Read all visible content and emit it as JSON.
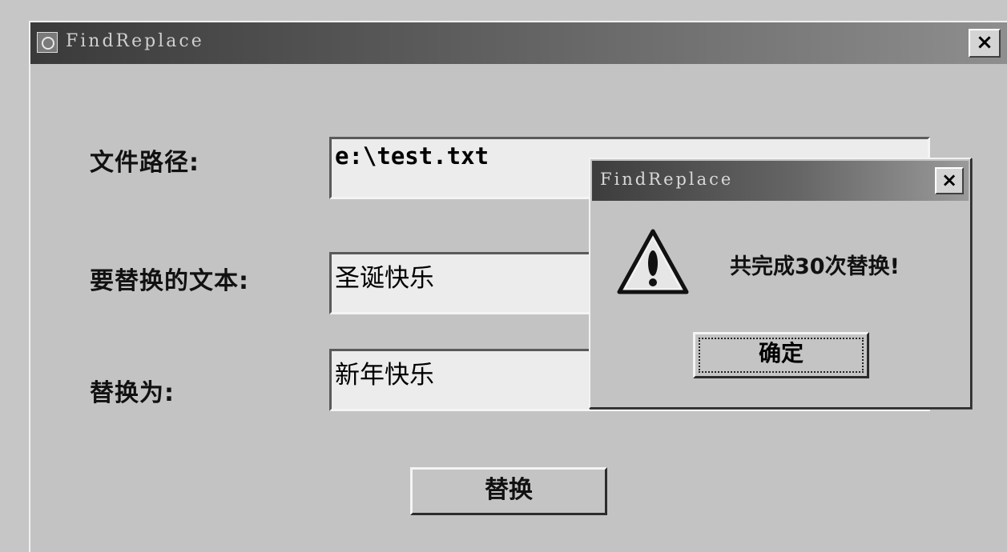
{
  "main_window": {
    "title": "FindReplace",
    "close_label": "×"
  },
  "form": {
    "file_path_label": "文件路径:",
    "file_path_value": "e:\\test.txt",
    "search_text_label": "要替换的文本:",
    "search_text_value": "圣诞快乐",
    "replace_with_label": "替换为:",
    "replace_with_value": "新年快乐",
    "replace_button": "替换"
  },
  "message_box": {
    "title": "FindReplace",
    "close_label": "×",
    "icon": "warning-icon",
    "message": "共完成30次替换!",
    "ok_button": "确定"
  }
}
